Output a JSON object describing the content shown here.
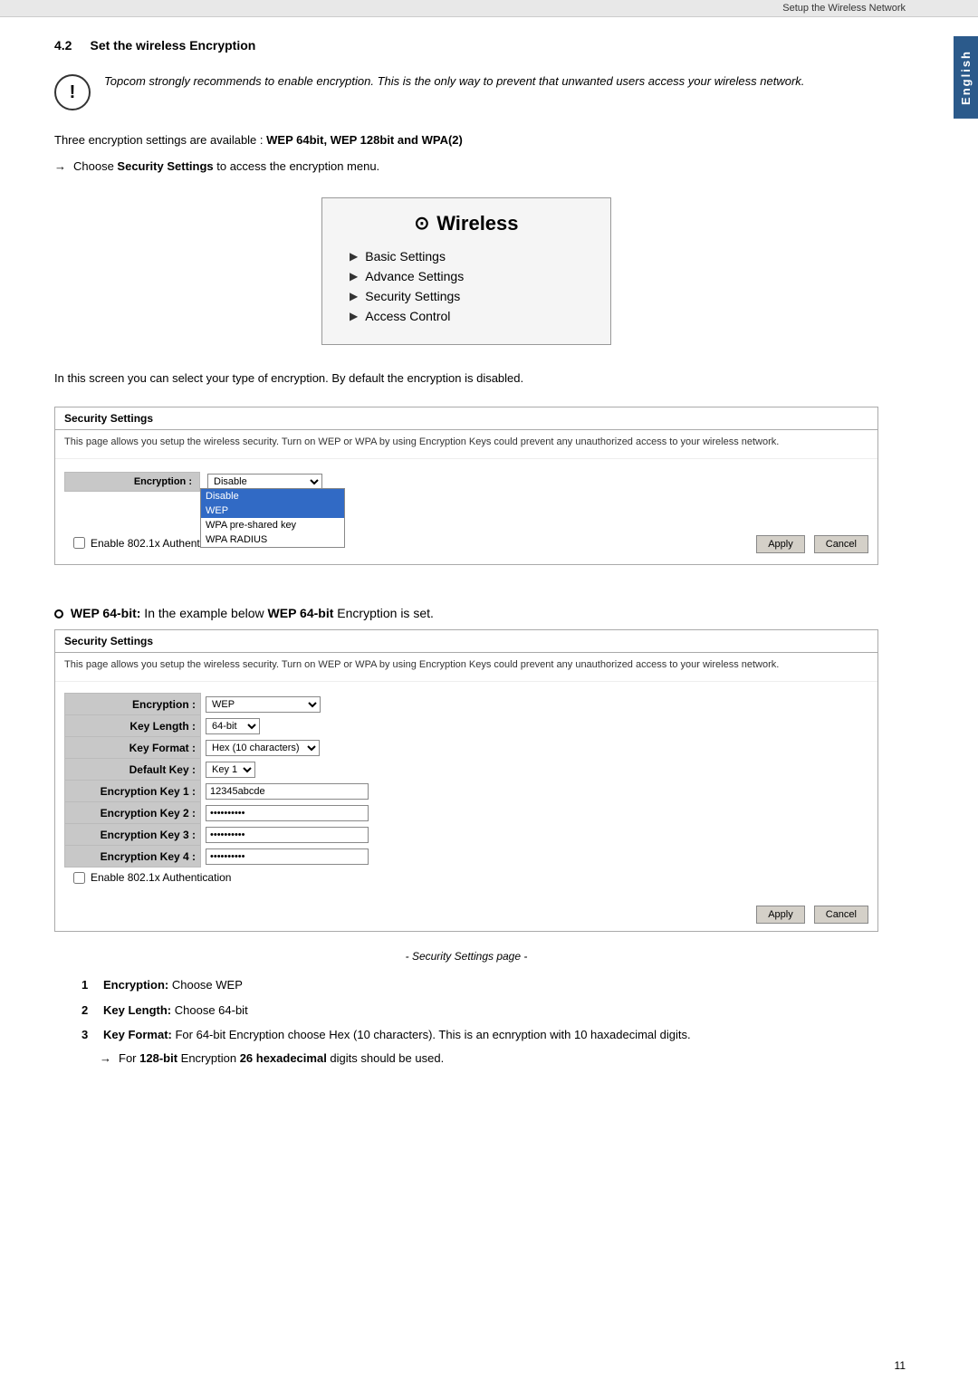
{
  "topBar": {
    "text": "Setup the Wireless Network"
  },
  "sideTab": {
    "label": "English"
  },
  "section": {
    "number": "4.2",
    "title": "Set the wireless Encryption"
  },
  "infoBox": {
    "text": "Topcom strongly recommends to enable encryption. This is the only way to prevent that unwanted users access your wireless network."
  },
  "para1": {
    "text": "Three encryption settings are available : ",
    "options": "WEP 64bit, WEP 128bit and WPA(2)"
  },
  "arrowItem1": {
    "prefix": "→ Choose ",
    "bold": "Security Settings",
    "suffix": " to access the encryption menu."
  },
  "wirelessMenu": {
    "title": "Wireless",
    "items": [
      {
        "label": "Basic Settings"
      },
      {
        "label": "Advance Settings"
      },
      {
        "label": "Security Settings"
      },
      {
        "label": "Access Control"
      }
    ]
  },
  "para2": {
    "text": "In this screen you can select your type of encryption. By default the encryption is disabled."
  },
  "securityPanel1": {
    "header": "Security Settings",
    "desc": "This page allows you setup the wireless security. Turn on WEP or WPA by using Encryption Keys could prevent any unauthorized access to your wireless network.",
    "encryption": {
      "label": "Encryption :",
      "value": "Disable",
      "options": [
        "Disable",
        "WEP",
        "WPA pre-shared key",
        "WPA RADIUS"
      ]
    },
    "checkbox": {
      "label": "Enable 802.1x Authentication"
    },
    "buttons": {
      "apply": "Apply",
      "cancel": "Cancel"
    }
  },
  "wepHeading": {
    "bullet": "○",
    "bold": "WEP 64-bit:",
    "text": " In the example below ",
    "bold2": "WEP 64-bit",
    "text2": " Encryption is set."
  },
  "securityPanel2": {
    "header": "Security Settings",
    "desc": "This page allows you setup the wireless security. Turn on WEP or WPA by using Encryption Keys could prevent any unauthorized access to your wireless network.",
    "fields": [
      {
        "label": "Encryption :",
        "type": "select",
        "value": "WEP"
      },
      {
        "label": "Key Length :",
        "type": "select",
        "value": "64-bit"
      },
      {
        "label": "Key Format :",
        "type": "select",
        "value": "Hex (10 characters)"
      },
      {
        "label": "Default Key :",
        "type": "select",
        "value": "Key 1"
      },
      {
        "label": "Encryption Key 1 :",
        "type": "text",
        "value": "12345abcde"
      },
      {
        "label": "Encryption Key 2 :",
        "type": "password",
        "value": "**********"
      },
      {
        "label": "Encryption Key 3 :",
        "type": "password",
        "value": "**********"
      },
      {
        "label": "Encryption Key 4 :",
        "type": "password",
        "value": "**********"
      }
    ],
    "checkbox": {
      "label": "Enable 802.1x Authentication"
    },
    "buttons": {
      "apply": "Apply",
      "cancel": "Cancel"
    }
  },
  "caption": {
    "text": "- Security Settings page -"
  },
  "numberedList": {
    "items": [
      {
        "num": "1",
        "bold": "Encryption:",
        "text": " Choose WEP"
      },
      {
        "num": "2",
        "bold": "Key Length:",
        "text": " Choose 64-bit"
      },
      {
        "num": "3",
        "bold": "Key Format:",
        "text": " For 64-bit Encryption choose Hex (10 characters). This is an ecnryption with 10 haxadecimal digits."
      }
    ]
  },
  "arrowItem2": {
    "prefix": "→ For ",
    "bold1": "128-bit",
    "middle": " Encryption ",
    "bold2": "26 hexadecimal",
    "suffix": " digits should be used."
  },
  "pageNumber": "11"
}
